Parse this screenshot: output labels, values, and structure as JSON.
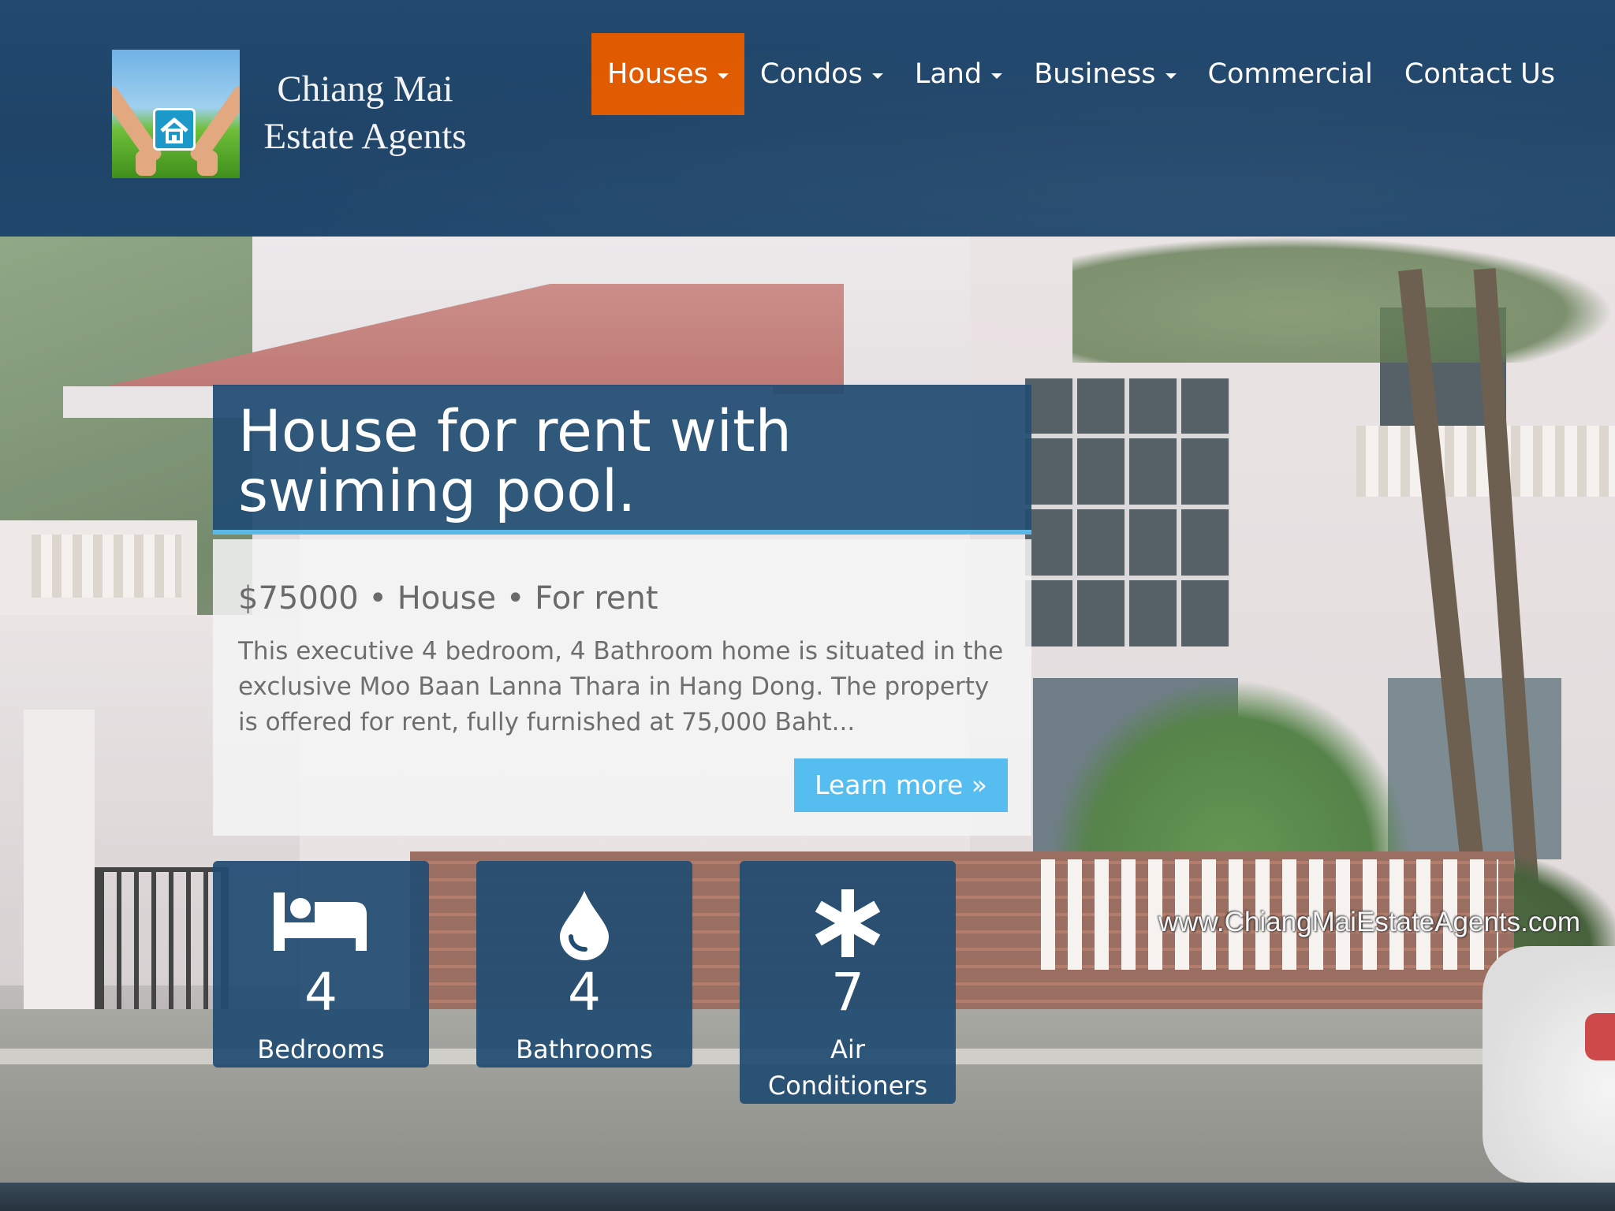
{
  "brand": {
    "line1": "Chiang Mai",
    "line2": "Estate Agents"
  },
  "nav": {
    "items": [
      {
        "label": "Houses",
        "dropdown": true,
        "active": true
      },
      {
        "label": "Condos",
        "dropdown": true
      },
      {
        "label": "Land",
        "dropdown": true
      },
      {
        "label": "Business",
        "dropdown": true
      },
      {
        "label": "Commercial",
        "dropdown": false
      },
      {
        "label": "Contact Us",
        "dropdown": false
      }
    ]
  },
  "listing": {
    "title": "House for rent with swiming pool.",
    "price": "$75000",
    "type": "House",
    "status": "For rent",
    "separator": "•",
    "description": "This executive 4 bedroom, 4 Bathroom home is situated in the exclusive Moo Baan Lanna Thara in Hang Dong. The property is offered for rent, fully furnished at 75,000 Baht...",
    "cta": "Learn more »"
  },
  "features": [
    {
      "icon": "bed-icon",
      "value": "4",
      "label": "Bedrooms"
    },
    {
      "icon": "water-drop-icon",
      "value": "4",
      "label": "Bathrooms"
    },
    {
      "icon": "asterisk-icon",
      "value": "7",
      "label": "Air Conditioners"
    }
  ],
  "watermark": "www.ChiangMaiEstateAgents.com",
  "colors": {
    "header": "#1f4468",
    "nav_active": "#e05a00",
    "panel": "#214c72",
    "accent": "#5cb8e6",
    "button": "#56bdf1"
  }
}
